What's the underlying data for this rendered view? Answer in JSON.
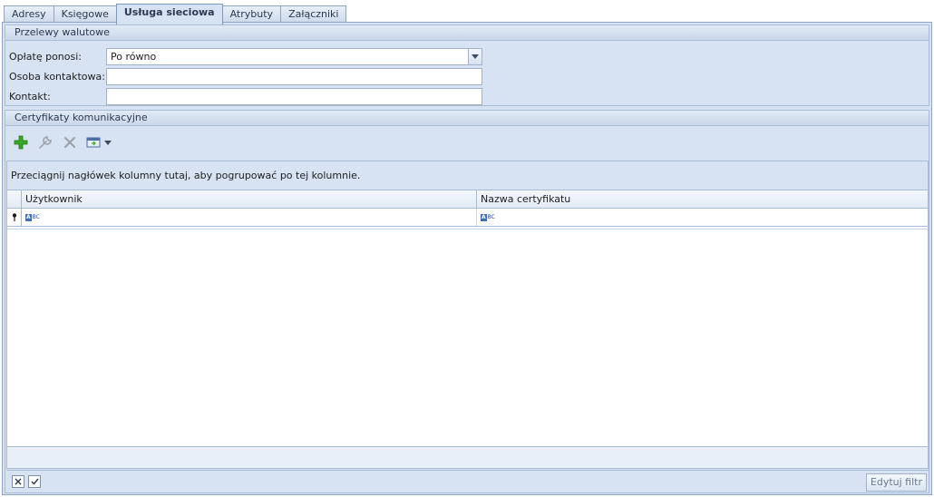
{
  "tabs": [
    {
      "label": "Adresy"
    },
    {
      "label": "Księgowe"
    },
    {
      "label": "Usługa sieciowa"
    },
    {
      "label": "Atrybuty"
    },
    {
      "label": "Załączniki"
    }
  ],
  "active_tab": "Usługa sieciowa",
  "section_transfers": {
    "title": "Przelewy walutowe",
    "fee_label": "Opłatę ponosi:",
    "fee_value": "Po równo",
    "contact_person_label": "Osoba kontaktowa:",
    "contact_person_value": "",
    "contact_label": "Kontakt:",
    "contact_value": ""
  },
  "section_certs": {
    "title": "Certyfikaty komunikacyjne",
    "toolbar_icons": [
      "add-icon",
      "edit-wrench-icon",
      "delete-icon",
      "export-icon",
      "dropdown-arrow-icon"
    ],
    "group_panel_text": "Przeciągnij nagłówek kolumny tutaj, aby pogrupować po tej kolumnie.",
    "columns": [
      "Użytkownik",
      "Nazwa certyfikatu"
    ],
    "filter_cell_marker": "ABC",
    "rows": []
  },
  "bottom_bar": {
    "clear_filter_icon": "close-x-icon",
    "filter_enabled_icon": "checkbox-checked-icon",
    "edit_filter_label": "Edytuj filtr"
  },
  "colors": {
    "panel_bg": "#d7e3f2",
    "border": "#8ea6c4",
    "header_gradient_top": "#e2ebf6",
    "add_green": "#3aa626"
  }
}
